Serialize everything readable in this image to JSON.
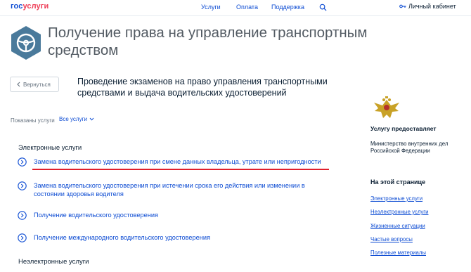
{
  "header": {
    "logo_part1": "гос",
    "logo_part2": "услуги",
    "nav": [
      "Услуги",
      "Оплата",
      "Поддержка"
    ],
    "cabinet_label": "Личный кабинет"
  },
  "page": {
    "title": "Получение права на управление транспортным средством",
    "back_label": "Вернуться",
    "section_title": "Проведение экзаменов на право управления транспортными средствами и выдача водительских удостоверений",
    "shown_label": "Показаны услуги",
    "filter_value": "Все услуги"
  },
  "electronic": {
    "title": "Электронные услуги",
    "items": [
      "Замена водительского удостоверения при смене данных владельца, утрате или непригодности",
      "Замена водительского удостоверения при истечении срока его действия или изменении в состоянии здоровья водителя",
      "Получение водительского удостоверения",
      "Получение международного водительского удостоверения"
    ]
  },
  "nonelectronic": {
    "title": "Неэлектронные услуги"
  },
  "provider": {
    "title": "Услугу предоставляет",
    "name": "Министерство внутренних дел Российской Федерации"
  },
  "onpage": {
    "title": "На этой странице",
    "links": [
      "Электронные услуги",
      "Неэлектронные услуги",
      "Жизненные ситуации",
      "Частые вопросы",
      "Полезные материалы"
    ]
  },
  "colors": {
    "brand_blue": "#0d4cd3",
    "brand_red": "#ee3f58",
    "icon_teal": "#4a7a9b",
    "highlight_red": "#e01f2c"
  }
}
